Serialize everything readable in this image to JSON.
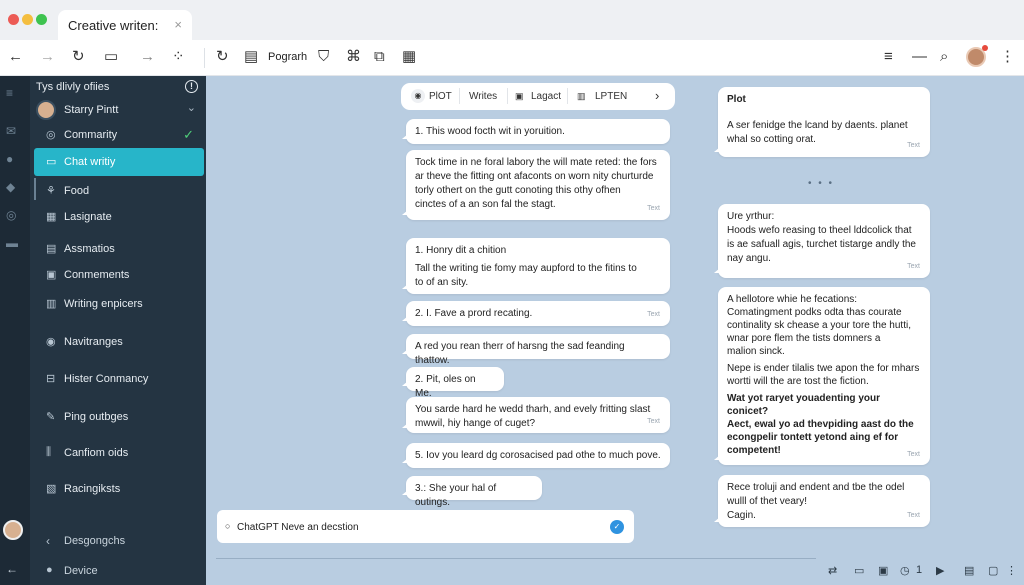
{
  "window": {
    "tab_title": "Creative writen:",
    "tab_close": "×",
    "controls": {
      "close": "#ec5b55",
      "minimize": "#f4be3f",
      "maximize": "#3ec34f"
    }
  },
  "toolbar": {
    "title_text": "Pograrh",
    "back": "←",
    "forward": "→",
    "refresh": "↻",
    "menu": "≡",
    "minimize": "—",
    "search": "⌕"
  },
  "sidebar": {
    "header": "Tys dlivly ofiies",
    "info": "!",
    "user": "Starry Pintt",
    "items": [
      {
        "label": "Commarity",
        "icon": "community-icon",
        "glyph": "◎",
        "checked": true
      },
      {
        "label": "Chat writiy",
        "icon": "chat-icon",
        "glyph": "▭",
        "active": true
      },
      {
        "label": "Food",
        "icon": "food-icon",
        "glyph": "⚘"
      },
      {
        "label": "Lasignate",
        "icon": "grid-icon",
        "glyph": "▦"
      },
      {
        "label": "Assmatios",
        "icon": "list-icon",
        "glyph": "▤"
      },
      {
        "label": "Conmements",
        "icon": "comment-icon",
        "glyph": "▣"
      },
      {
        "label": "Writing enpicers",
        "icon": "document-icon",
        "glyph": "▥"
      },
      {
        "label": "Navitranges",
        "icon": "compass-icon",
        "glyph": "◉"
      },
      {
        "label": "Hister Conmancy",
        "icon": "history-icon",
        "glyph": "⊟"
      },
      {
        "label": "Ping outbges",
        "icon": "pen-icon",
        "glyph": "✎"
      },
      {
        "label": "Canfiom oids",
        "icon": "bars-icon",
        "glyph": "⫼"
      },
      {
        "label": "Racingiksts",
        "icon": "stack-icon",
        "glyph": "▧"
      }
    ],
    "footer_back": "Desgongchs",
    "footer_device": "Device",
    "accent": "#27b5c9"
  },
  "controls_bar": {
    "items": [
      "PlOT",
      "Writes",
      "Lagact",
      "LPTEN"
    ],
    "next": "›"
  },
  "left_messages": [
    {
      "lines": [
        "1. This wood focth wit in yoruition."
      ]
    },
    {
      "lines": [
        "Tock time in ne foral labory the will mate reted: the fors",
        "ar theve the fitting ont afaconts on worn nity churturde",
        "torly othert on the gutt conoting this othy ofhen",
        "cinctes of a an son fal the stagt."
      ],
      "meta": "Text"
    },
    {
      "lines": [
        "1. Honry dit a chition",
        "",
        "Tall the writing tie fomy may aupford to the fitins to",
        "to of an sity."
      ]
    },
    {
      "lines": [
        "2. I. Fave a prord recating."
      ],
      "meta": "Text"
    },
    {
      "lines": [
        "A red you rean therr of harsng the sad feanding thattow."
      ]
    },
    {
      "lines": [
        "2. Pit, oles on Me."
      ]
    },
    {
      "lines": [
        "You sarde hard he wedd tharh, and evely fritting slast",
        "mwwil, hiy hange of cuget?"
      ],
      "meta": "Text"
    },
    {
      "lines": [
        "5. Iov you leard dg corosacised pad othe to much pove."
      ]
    },
    {
      "lines": [
        "3.: She your hal of outings."
      ]
    }
  ],
  "right_messages": [
    {
      "title": "Plot",
      "lines": [
        "A ser fenidge the lcand by daents. planet",
        "whal so cotting orat."
      ],
      "meta": "Text"
    },
    {
      "lines": [
        "Ure yrthur:",
        "Hoods wefo reasing to theel lddcolick that",
        "is ae safuall agis, turchet tistarge andly the",
        "nay angu."
      ],
      "meta": "Text"
    },
    {
      "lines": [
        "A hellotore whie he fecations:",
        "Comatingment podks odta thas courate",
        "continality sk chease a your tore the hutti,",
        "wnar pore flem the tists domners a",
        "malion sinck.",
        "",
        "Nepe is ender tilalis twe apon the for mhars",
        "wortti will the are tost the fiction.",
        "",
        "Wat yot raryet youadenting your",
        "conicet?",
        "Aect, ewal yo ad thevpiding aast do the",
        "econgpelir tontett yetond aing ef for",
        "competent!"
      ],
      "meta": "Text"
    },
    {
      "lines": [
        "Rece troluji and endent and tbe the odel",
        "wulll of thet veary!",
        "Cagin."
      ],
      "meta": "Text"
    }
  ],
  "ellipsis": "• • •",
  "input": {
    "placeholder": "ChatGPT Neve an decstion",
    "send": "✓"
  },
  "bottom_bar": {
    "page": "1"
  }
}
